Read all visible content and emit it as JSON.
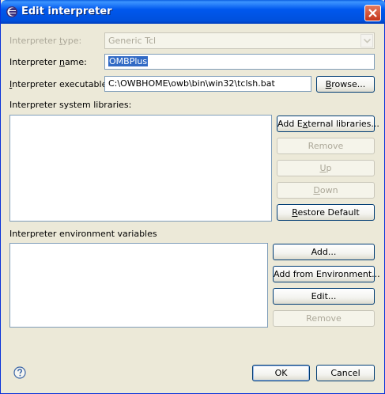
{
  "window": {
    "title": "Edit interpreter"
  },
  "colors": {
    "titlebar": "#0058ee",
    "face": "#ece9d8",
    "selection": "#316ac5",
    "disabled_text": "#aca899"
  },
  "form": {
    "type_label": {
      "before": "Interpreter ",
      "accel": "t",
      "after": "ype:"
    },
    "type_value": "Generic Tcl",
    "name_label": {
      "before": "Interpreter ",
      "accel": "n",
      "after": "ame:"
    },
    "name_value": "OMBPlus",
    "executable_label": {
      "before": "",
      "accel": "I",
      "after": "nterpreter executable:"
    },
    "executable_value": "C:\\OWBHOME\\owb\\bin\\win32\\tclsh.bat",
    "browse": {
      "before": "",
      "accel": "B",
      "after": "rowse..."
    }
  },
  "libraries": {
    "label": "Interpreter system libraries:",
    "add_external": {
      "before": "Add E",
      "accel": "x",
      "after": "ternal libraries..."
    },
    "remove": "Remove",
    "up": {
      "before": "",
      "accel": "U",
      "after": "p"
    },
    "down": {
      "before": "",
      "accel": "D",
      "after": "own"
    },
    "restore": {
      "before": "",
      "accel": "R",
      "after": "estore Default"
    }
  },
  "environment": {
    "label": "Interpreter environment variables",
    "add": "Add...",
    "add_from_env": "Add from Environment...",
    "edit": "Edit...",
    "remove": "Remove"
  },
  "footer": {
    "ok": "OK",
    "cancel": "Cancel",
    "help_icon": "question-mark-circle"
  }
}
